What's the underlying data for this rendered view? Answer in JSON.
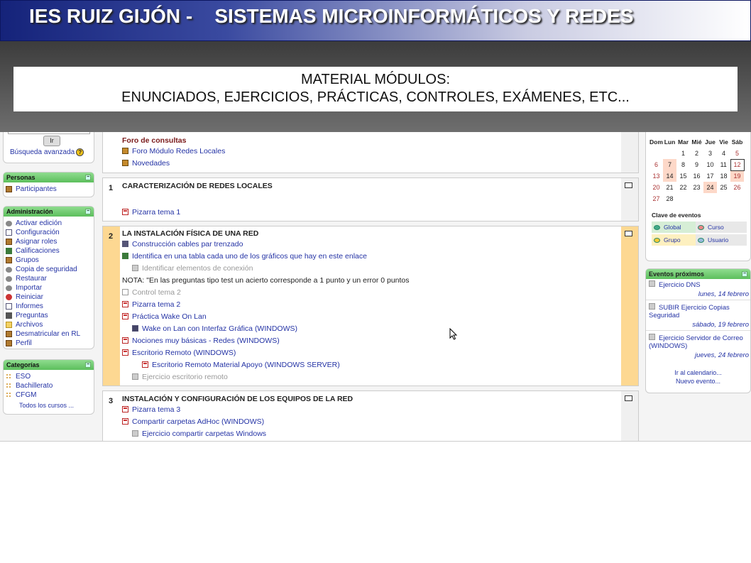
{
  "banner": {
    "title": "IES RUIZ GIJÓN -    SISTEMAS MICROINFORMÁTICOS Y REDES"
  },
  "slide_box": {
    "line1": "MATERIAL MÓDULOS:",
    "line2": "ENUNCIADOS, EJERCICIOS, PRÁCTICAS, CONTROLES, EXÁMENES, ETC..."
  },
  "search": {
    "button": "Ir",
    "advanced": "Búsqueda avanzada"
  },
  "personas": {
    "title": "Personas",
    "items": [
      "Participantes"
    ]
  },
  "admin": {
    "title": "Administración",
    "items": [
      "Activar edición",
      "Configuración",
      "Asignar roles",
      "Calificaciones",
      "Grupos",
      "Copia de seguridad",
      "Restaurar",
      "Importar",
      "Reiniciar",
      "Informes",
      "Preguntas",
      "Archivos",
      "Desmatricular en RL",
      "Perfil"
    ]
  },
  "categorias": {
    "title": "Categorías",
    "items": [
      "ESO",
      "Bachillerato",
      "CFGM"
    ],
    "all": "Todos los cursos ..."
  },
  "sec0": {
    "title": "Foro de consultas",
    "items": [
      "Foro Módulo Redes Locales",
      "Novedades"
    ]
  },
  "sec1": {
    "num": "1",
    "title": "CARACTERIZACIÓN DE REDES LOCALES",
    "items": [
      "Pizarra tema 1"
    ]
  },
  "sec2": {
    "num": "2",
    "title": "LA INSTALACIÓN FÍSICA DE UNA RED",
    "items": [
      "Construcción cables par trenzado",
      "Identifica en una tabla cada uno de los gráficos que hay en este enlace",
      "Identificar elementos de conexión",
      "NOTA: \"En las preguntas tipo test un acierto corresponde a 1 punto y un error 0 puntos",
      "Control tema 2",
      "Pizarra tema 2",
      "Práctica Wake On Lan",
      "Wake on Lan con Interfaz Gráfica (WINDOWS)",
      "Nociones muy básicas - Redes (WINDOWS)",
      "Escritorio Remoto (WINDOWS)",
      "Escritorio Remoto Material Apoyo (WINDOWS SERVER)",
      "Ejercicio escritorio remoto"
    ]
  },
  "sec3": {
    "num": "3",
    "title": "INSTALACIÓN Y CONFIGURACIÓN DE LOS EQUIPOS DE LA RED",
    "items": [
      "Pizarra tema 3",
      "Compartir carpetas AdHoc (WINDOWS)",
      "Ejercicio compartir carpetas Windows"
    ]
  },
  "calendar": {
    "days": [
      "Dom",
      "Lun",
      "Mar",
      "Mié",
      "Jue",
      "Vie",
      "Sáb"
    ],
    "weeks": [
      [
        "",
        "",
        "1",
        "2",
        "3",
        "4",
        "5"
      ],
      [
        "6",
        "7",
        "8",
        "9",
        "10",
        "11",
        "12"
      ],
      [
        "13",
        "14",
        "15",
        "16",
        "17",
        "18",
        "19"
      ],
      [
        "20",
        "21",
        "22",
        "23",
        "24",
        "25",
        "26"
      ],
      [
        "27",
        "28",
        "",
        "",
        "",
        "",
        ""
      ]
    ]
  },
  "key": {
    "title": "Clave de eventos",
    "global": "Global",
    "curso": "Curso",
    "grupo": "Grupo",
    "usuario": "Usuario"
  },
  "upcoming": {
    "title": "Eventos próximos",
    "events": [
      {
        "name": "Ejercicio DNS",
        "date": "lunes, 14 febrero"
      },
      {
        "name": "SUBIR Ejercicio Copias Seguridad",
        "date": "sábado, 19 febrero"
      },
      {
        "name": "Ejercicio Servidor de Correo (WINDOWS)",
        "date": "jueves, 24 febrero"
      }
    ],
    "goto": "Ir al calendario...",
    "new": "Nuevo evento..."
  },
  "colors": {
    "accent_green": "#5cbf5c",
    "highlight": "#fdd892",
    "link": "#2433a5"
  }
}
